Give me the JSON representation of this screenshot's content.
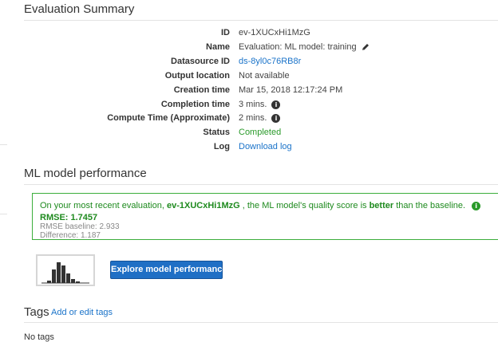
{
  "summary": {
    "title": "Evaluation Summary",
    "rows": [
      {
        "label": "ID",
        "value": "ev-1XUCxHi1MzG"
      },
      {
        "label": "Name",
        "value": "Evaluation: ML model: training"
      },
      {
        "label": "Datasource ID",
        "value": "ds-8yl0c76RB8r"
      },
      {
        "label": "Output location",
        "value": "Not available"
      },
      {
        "label": "Creation time",
        "value": "Mar 15, 2018 12:17:24 PM"
      },
      {
        "label": "Completion time",
        "value": "3 mins."
      },
      {
        "label": "Compute Time (Approximate)",
        "value": "2 mins."
      },
      {
        "label": "Status",
        "value": "Completed"
      },
      {
        "label": "Log",
        "value": "Download log"
      }
    ]
  },
  "performance": {
    "title": "ML model performance",
    "alert": {
      "prefix": "On your most recent evaluation,",
      "eval_id": "ev-1XUCxHi1MzG",
      "middle": ", the ML model's quality score is",
      "emphasis": "better",
      "suffix": "than the baseline.",
      "rmse": "RMSE: 1.7457",
      "baseline": "RMSE baseline: 2.933",
      "difference": "Difference: 1.187"
    },
    "button_label": "Explore model performance"
  },
  "tags": {
    "title": "Tags",
    "edit_link": "Add or edit tags",
    "empty_text": "No tags"
  },
  "colors": {
    "accent": "#1f6fc5",
    "link": "#1a73c9",
    "success": "#2a9a2a",
    "alert_border": "#3cae3c"
  },
  "icons": {
    "edit": "pencil-icon",
    "info": "info-icon"
  }
}
